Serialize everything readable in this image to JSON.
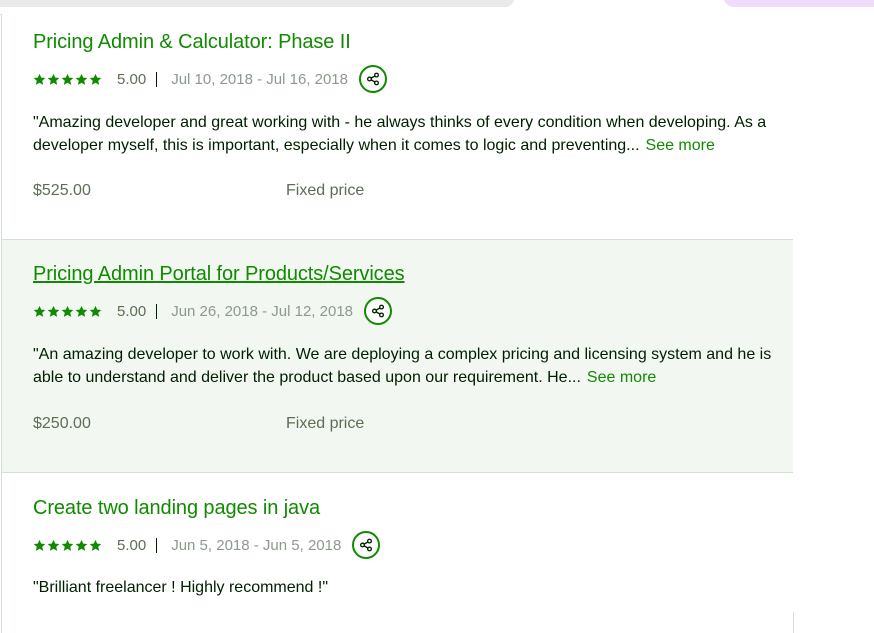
{
  "colors": {
    "accent": "#108a00",
    "text": "#001e00",
    "muted": "#5e6d55",
    "highlight_bg": "#f2f7f2"
  },
  "icons": {
    "rating": "star-icon",
    "share": "share-icon"
  },
  "jobs": [
    {
      "title": "Pricing Admin & Calculator: Phase II",
      "rating": "5.00",
      "stars": 5,
      "dates": "Jul 10, 2018 - Jul 16, 2018",
      "review": "\"Amazing developer and great working with - he always thinks of every condition when developing. As a developer myself, this is important, especially when it comes to logic and preventing...",
      "see_more": "See more",
      "price": "$525.00",
      "price_type": "Fixed price"
    },
    {
      "title": "Pricing Admin Portal for Products/Services",
      "rating": "5.00",
      "stars": 5,
      "dates": "Jun 26, 2018 - Jul 12, 2018",
      "review": "\"An amazing developer to work with. We are deploying a complex pricing and licensing system and he is able to understand and deliver the product based upon our requirement. He...",
      "see_more": "See more",
      "price": "$250.00",
      "price_type": "Fixed price"
    },
    {
      "title": "Create two landing pages in java",
      "rating": "5.00",
      "stars": 5,
      "dates": "Jun 5, 2018 - Jun 5, 2018",
      "review": "\"Brilliant freelancer ! Highly recommend !\""
    }
  ]
}
